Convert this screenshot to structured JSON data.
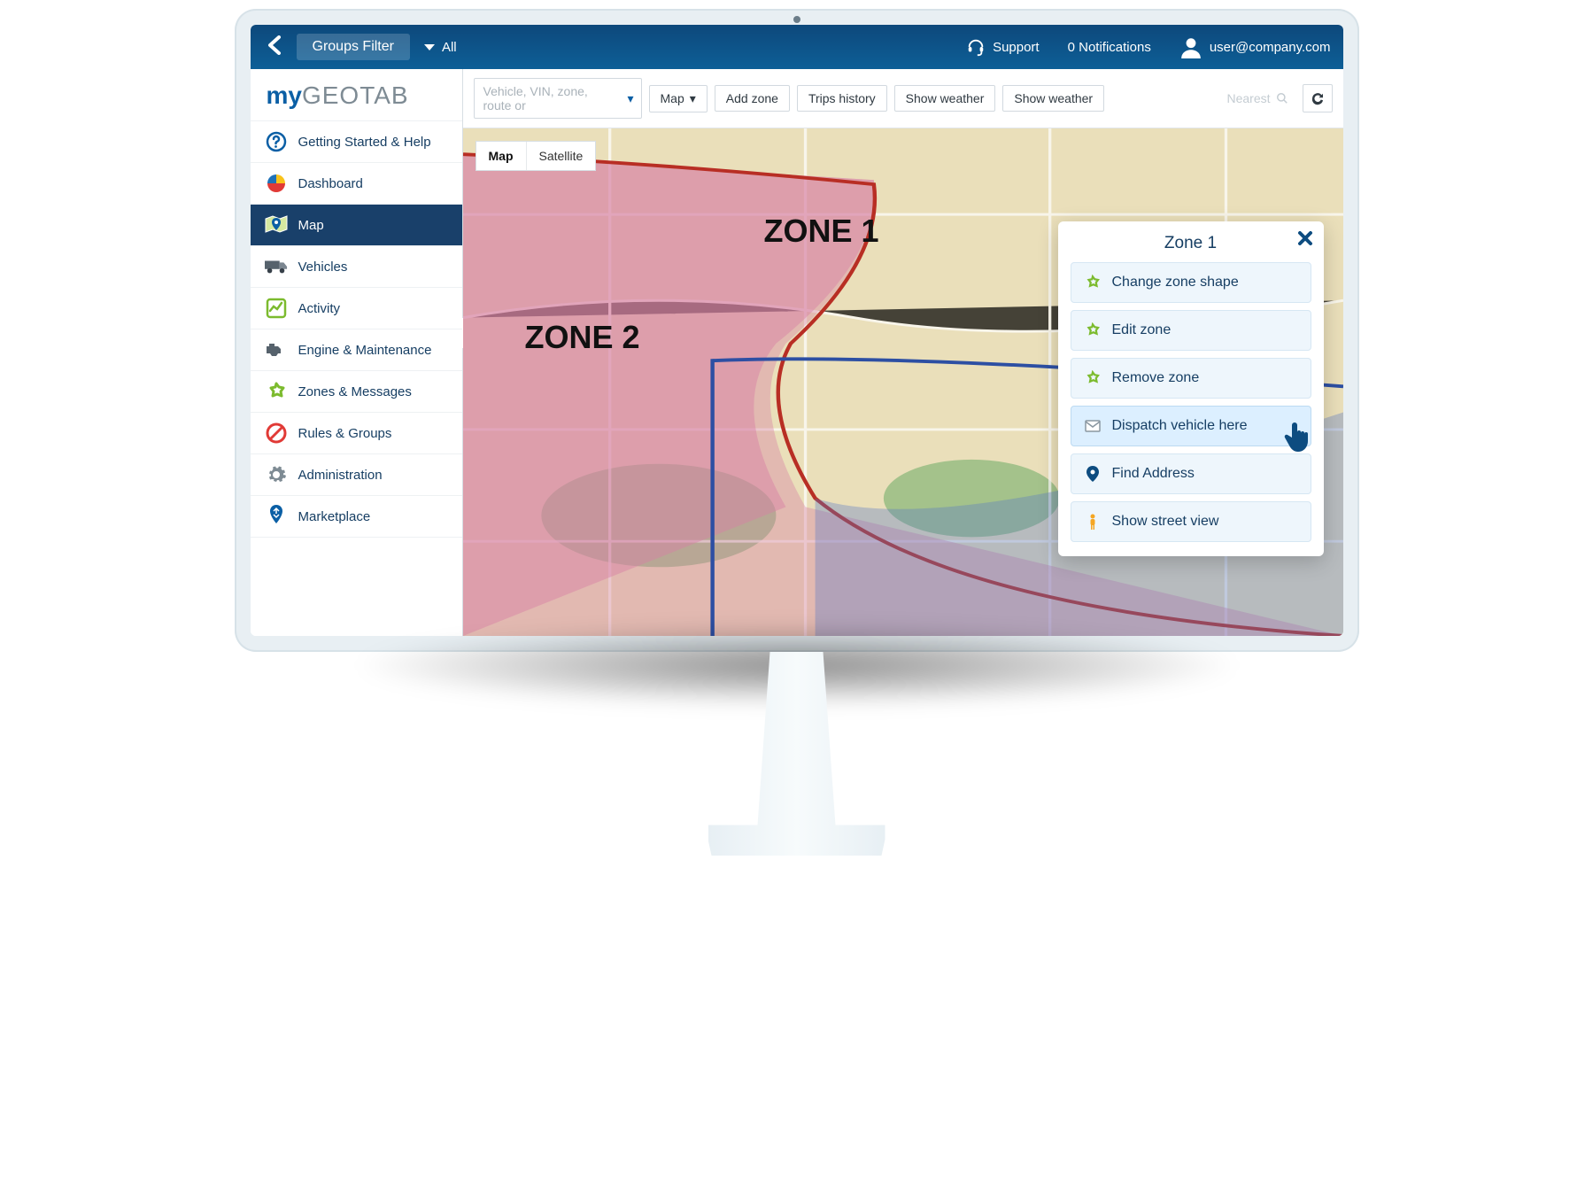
{
  "topbar": {
    "groups_filter": "Groups Filter",
    "all_label": "All",
    "support": "Support",
    "notifications": "0 Notifications",
    "user": "user@company.com"
  },
  "logo": {
    "my": "my",
    "brand": "GEOTAB"
  },
  "sidebar": {
    "items": [
      {
        "label": "Getting Started & Help"
      },
      {
        "label": "Dashboard"
      },
      {
        "label": "Map"
      },
      {
        "label": "Vehicles"
      },
      {
        "label": "Activity"
      },
      {
        "label": "Engine & Maintenance"
      },
      {
        "label": "Zones & Messages"
      },
      {
        "label": "Rules & Groups"
      },
      {
        "label": "Administration"
      },
      {
        "label": "Marketplace"
      }
    ]
  },
  "toolbar": {
    "search_placeholder": "Vehicle, VIN, zone, route or",
    "map_btn": "Map",
    "add_zone": "Add zone",
    "trips_history": "Trips history",
    "show_weather_1": "Show weather",
    "show_weather_2": "Show weather",
    "nearest": "Nearest"
  },
  "map": {
    "tabs": {
      "map": "Map",
      "satellite": "Satellite"
    },
    "zone1_label": "ZONE 1",
    "zone2_label": "ZONE 2"
  },
  "popup": {
    "title": "Zone 1",
    "items": [
      {
        "label": "Change zone shape"
      },
      {
        "label": "Edit zone"
      },
      {
        "label": "Remove zone"
      },
      {
        "label": "Dispatch vehicle here"
      },
      {
        "label": "Find Address"
      },
      {
        "label": "Show street view"
      }
    ]
  },
  "colors": {
    "primary": "#0d5f97",
    "accent_green": "#7cbb2e"
  }
}
